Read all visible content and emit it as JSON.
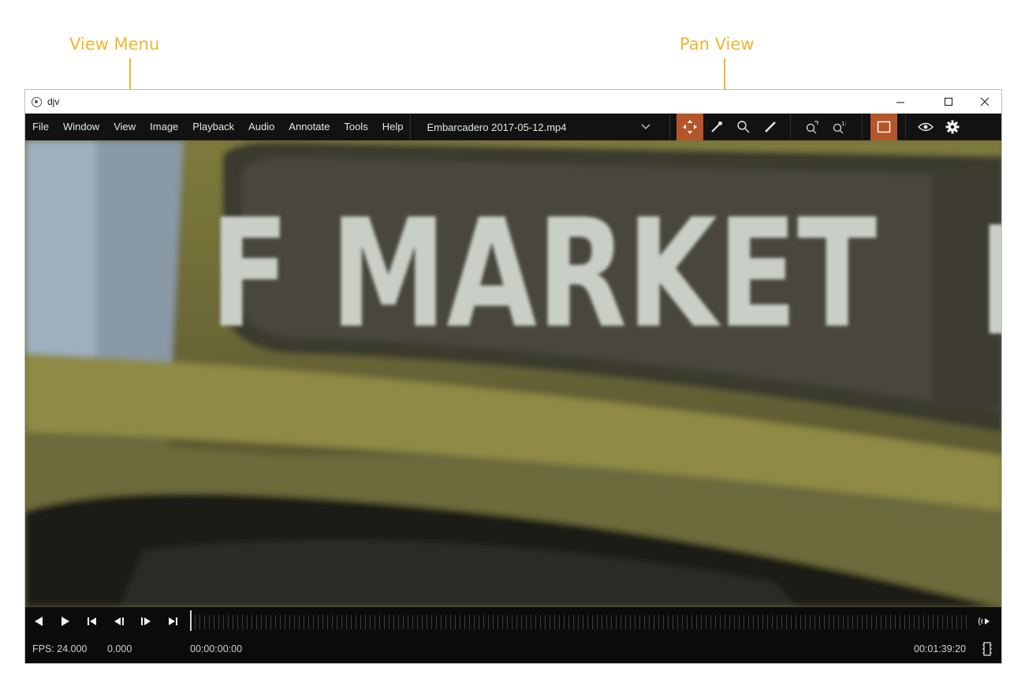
{
  "annotations": {
    "view_menu": "View Menu",
    "pan_view": "Pan View",
    "color": "#f2b630"
  },
  "window": {
    "title": "djv",
    "controls": [
      "minimize-icon",
      "maximize-icon",
      "close-icon"
    ]
  },
  "menu": {
    "items": [
      "File",
      "Window",
      "View",
      "Image",
      "Playback",
      "Audio",
      "Annotate",
      "Tools",
      "Help"
    ],
    "file_combo": "Embarcadero 2017-05-12.mp4"
  },
  "toolbar": {
    "tools": [
      "pan-icon",
      "color-picker-icon",
      "magnify-icon",
      "annotate-pencil-icon"
    ],
    "zoom": [
      "zoom-fit-icon",
      "zoom-actual-icon"
    ],
    "frame_toggle": "frame-icon",
    "right": [
      "eye-icon",
      "settings-gear-icon"
    ],
    "active_color": "#b5552a"
  },
  "viewport": {
    "sign_text": "F MARKET",
    "sign_text_right": "F"
  },
  "playback": {
    "buttons": [
      "play-reverse-icon",
      "play-forward-icon",
      "go-start-icon",
      "step-back-icon",
      "step-forward-icon",
      "go-end-icon"
    ],
    "audio_icon": "audio-icon",
    "playhead_position": 0
  },
  "status": {
    "fps": "FPS: 24.000",
    "speed": "0.000",
    "current_time": "00:00:00:00",
    "duration": "00:01:39:20",
    "cache_icon": "cache-icon"
  }
}
